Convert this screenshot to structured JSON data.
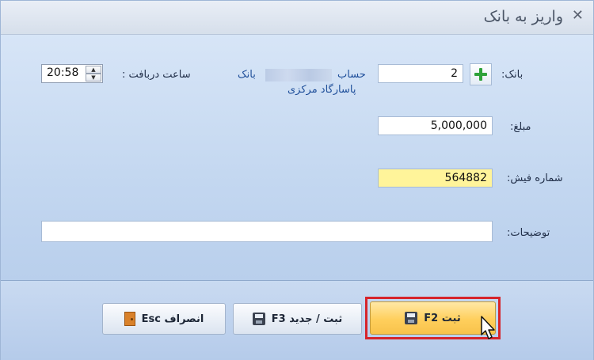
{
  "window": {
    "title": "واریز به بانک",
    "close_glyph": "✕"
  },
  "form": {
    "bank_label": "بانک:",
    "bank_code": "2",
    "account_text_line1": "حساب",
    "account_text_bank": "بانک",
    "account_text_line2": "پاسارگاد مرکزی",
    "receive_time_label": "ساعت دربافت :",
    "receive_time_value": "20:58",
    "amount_label": "مبلغ:",
    "amount_value": "5,000,000",
    "receipt_label": "شماره فیش:",
    "receipt_value": "564882",
    "notes_label": "توضیحات:",
    "notes_value": ""
  },
  "buttons": {
    "save_label": "ثبت F2",
    "save_new_label": "ثبت / جدید F3",
    "cancel_label": "انصراف Esc"
  },
  "icons": {
    "add": "plus-icon",
    "save": "floppy-disk-icon",
    "cancel": "exit-door-icon"
  },
  "colors": {
    "accent_highlight": "#d6242b",
    "active_field": "#fff49a",
    "primary_button": "#ffcf5c",
    "plus_green": "#2fa23a"
  }
}
